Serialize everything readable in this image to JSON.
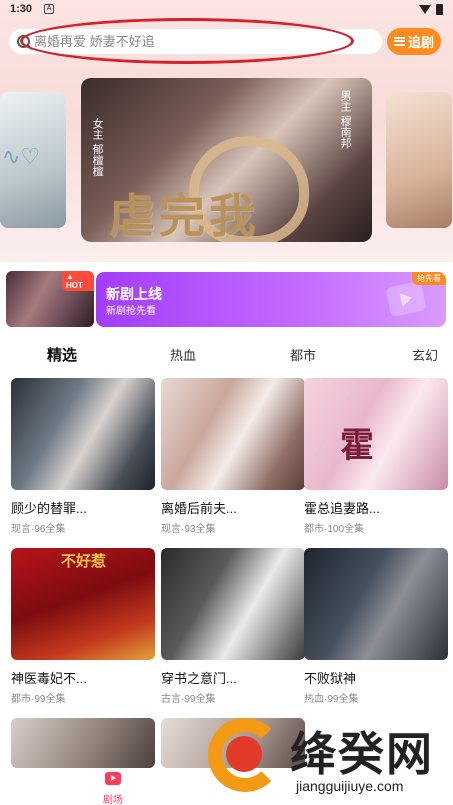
{
  "status_bar": {
    "time": "1:30",
    "notification": "A"
  },
  "search": {
    "placeholder": "离婚再爱 娇妻不好追"
  },
  "header": {
    "chase_label": "追剧"
  },
  "carousel": {
    "main_title_art": "虐完我",
    "main_role_left": "女主 郁檀檀",
    "main_role_right": "男主 穆南邦"
  },
  "promo": {
    "hot_badge": "HOT",
    "title": "新剧上线",
    "subtitle": "新剧抢先看",
    "corner_badge": "抢先看"
  },
  "tabs": [
    {
      "label": "精选",
      "active": true
    },
    {
      "label": "热血",
      "active": false
    },
    {
      "label": "都市",
      "active": false
    },
    {
      "label": "玄幻",
      "active": false
    }
  ],
  "dramas": [
    {
      "title": "顾少的替罪...",
      "meta": "现言·96全集",
      "poster_text": ""
    },
    {
      "title": "离婚后前夫...",
      "meta": "现言·93全集",
      "poster_text": ""
    },
    {
      "title": "霍总追妻路...",
      "meta": "都市·100全集",
      "poster_text": "霍"
    },
    {
      "title": "神医毒妃不...",
      "meta": "都市·99全集",
      "poster_text": "不好惹"
    },
    {
      "title": "穿书之意门...",
      "meta": "古言·99全集",
      "poster_text": ""
    },
    {
      "title": "不败狱神",
      "meta": "热血·99全集",
      "poster_text": ""
    }
  ],
  "tab_bar": {
    "theater_label": "剧场"
  },
  "watermark": {
    "brand": "绛癸网",
    "url": "jiangguijiuye.com"
  },
  "colors": {
    "accent_orange": "#ff8a1e",
    "promo_purple": "#a23dfa",
    "tab_active_red": "#ff3b5c",
    "annotation_red": "#d6202a"
  }
}
